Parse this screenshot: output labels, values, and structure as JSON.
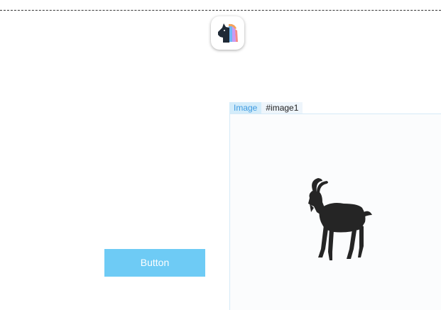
{
  "app": {
    "logo_icon": "unicorn-logo-icon"
  },
  "image_element": {
    "type_label": "Image",
    "id_label": "#image1",
    "content_icon": "goat-icon"
  },
  "button": {
    "label": "Button"
  },
  "colors": {
    "accent": "#6ecbf5",
    "tag_background": "#d3ecfa",
    "tag_text": "#3d9ae0"
  }
}
